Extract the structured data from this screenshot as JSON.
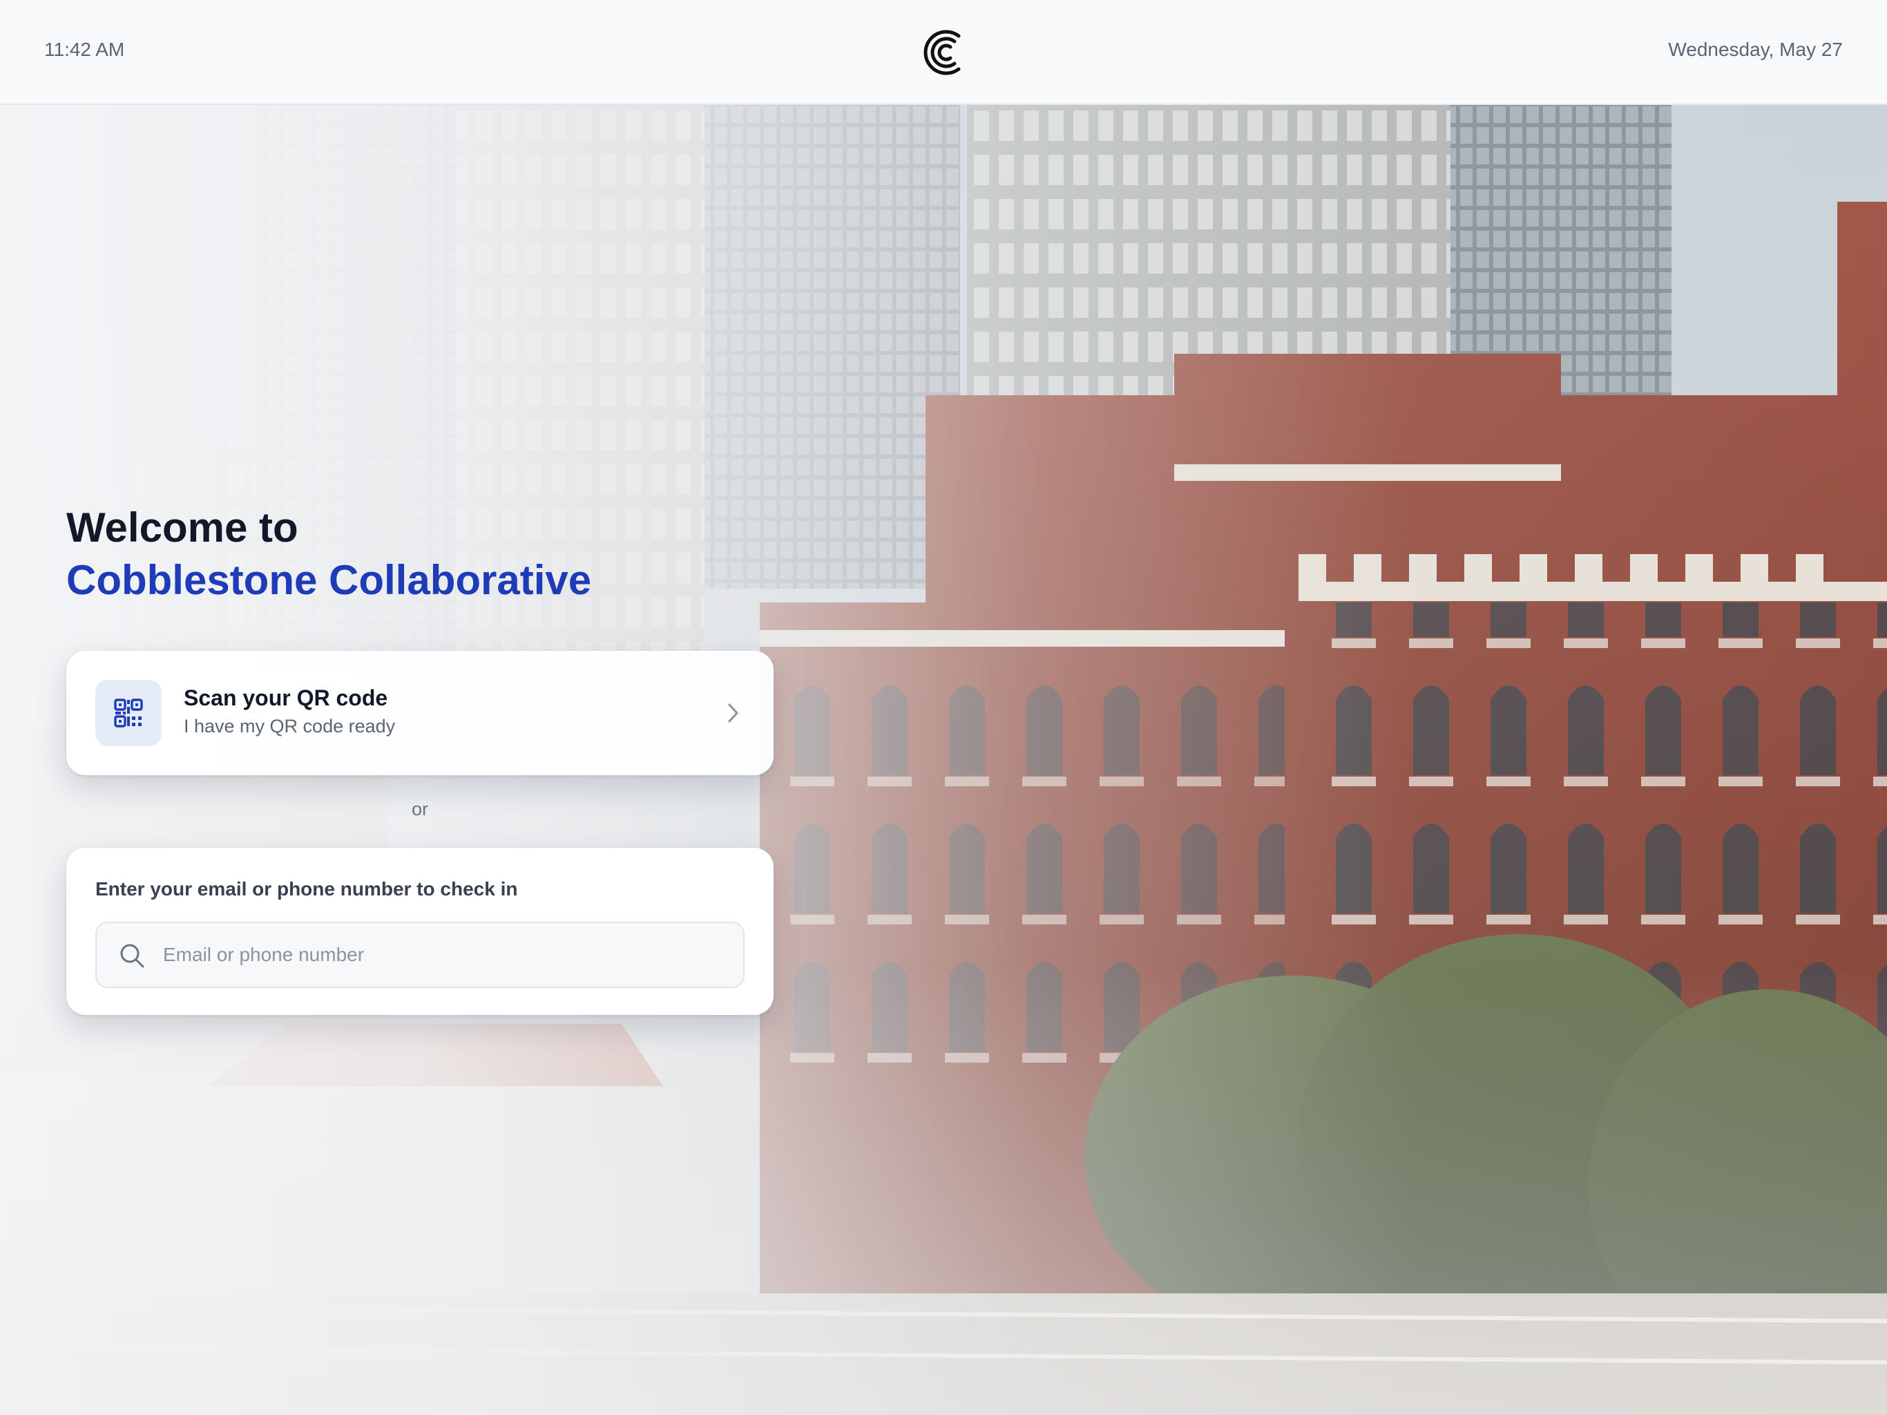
{
  "topbar": {
    "time": "11:42 AM",
    "date": "Wednesday, May 27",
    "logo_icon": "cobblestone-c-logo-icon"
  },
  "welcome": {
    "line1": "Welcome to",
    "line2": "Cobblestone Collaborative"
  },
  "qr_option": {
    "icon": "qr-code-icon",
    "title": "Scan your QR code",
    "subtitle": "I have my QR code ready",
    "chevron_icon": "chevron-right-icon"
  },
  "divider_text": "or",
  "email_checkin": {
    "label": "Enter your email or phone number to check in",
    "search_icon": "search-icon",
    "value": "",
    "placeholder": "Email or phone number"
  },
  "colors": {
    "accent": "#1e3bb8",
    "heading": "#111827",
    "muted": "#5b6472",
    "icon_bg": "#e6ebf8"
  }
}
